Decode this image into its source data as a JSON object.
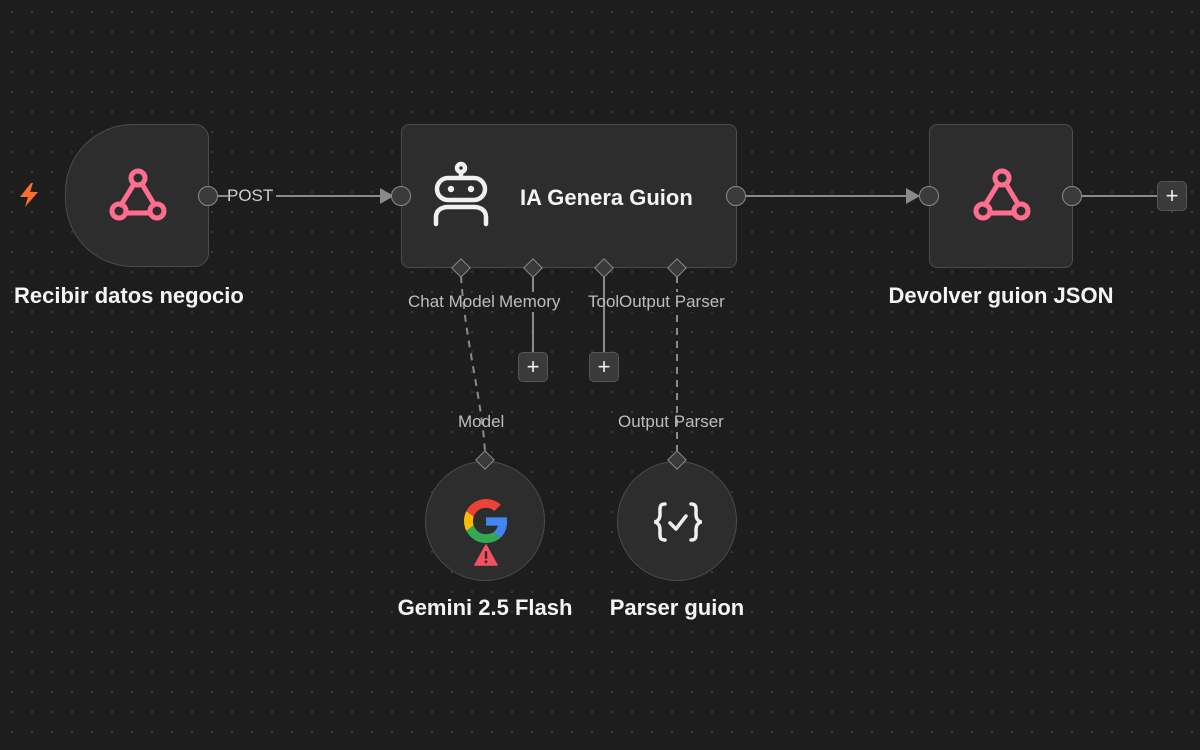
{
  "canvas": {
    "background": "#1d1d1d",
    "accent_pink": "#ff6d8f",
    "trigger_bolt_color": "#ff6d2d"
  },
  "nodes": {
    "webhook_in": {
      "title": "Recibir datos negocio",
      "icon": "webhook-icon"
    },
    "agent": {
      "title": "IA Genera Guion",
      "icon": "robot-icon"
    },
    "webhook_out": {
      "title": "Devolver guion JSON",
      "icon": "webhook-icon"
    },
    "model": {
      "title": "Gemini 2.5 Flash",
      "icon": "google-icon",
      "badge": "warning-icon"
    },
    "parser": {
      "title": "Parser guion",
      "icon": "structured-output-icon"
    }
  },
  "connections": {
    "post_label": "POST"
  },
  "agent_inputs": {
    "chat_model": "Chat Model",
    "memory": "Memory",
    "tool": "Tool",
    "output_parser": "Output Parser"
  },
  "subnode_outputs": {
    "model": "Model",
    "output_parser": "Output Parser"
  },
  "buttons": {
    "add": "+"
  }
}
